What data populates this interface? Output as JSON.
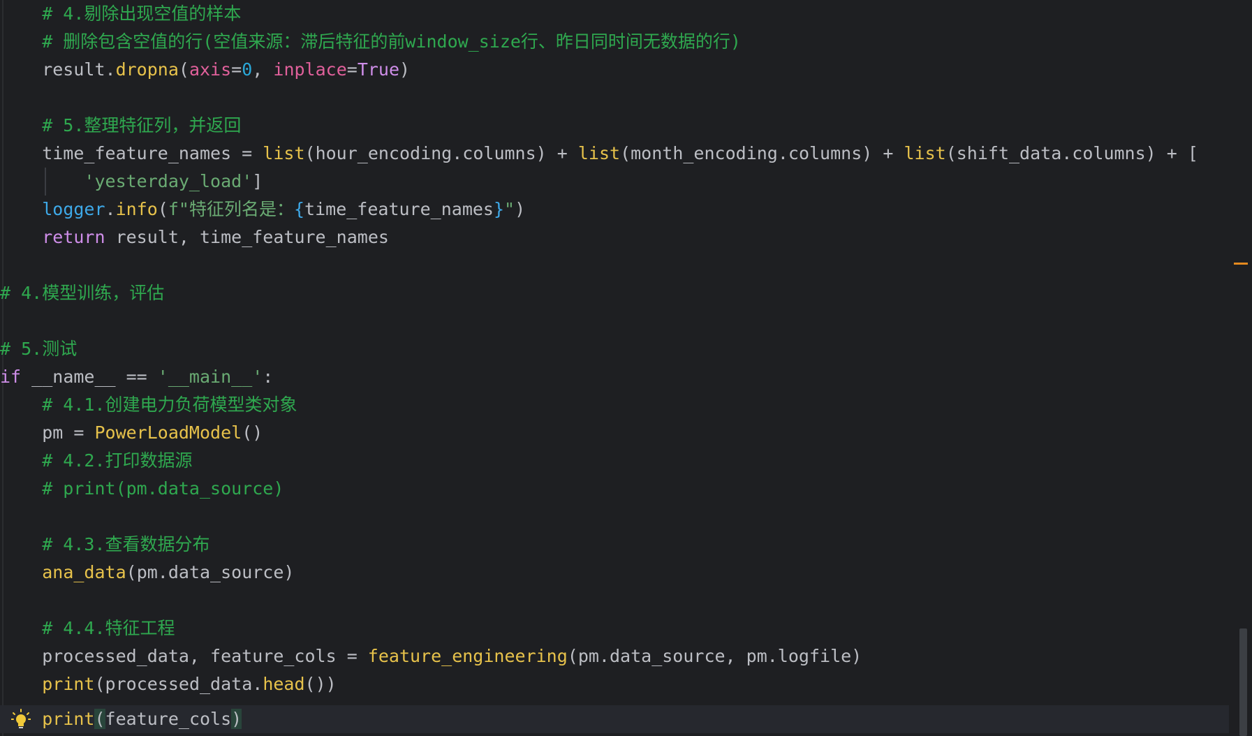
{
  "editor": {
    "language": "python",
    "colors": {
      "background": "#1e1f22",
      "comment": "#2fa84f",
      "function": "#e7c24b",
      "keyword": "#cf8ee9",
      "string": "#6aab73",
      "number": "#2aa8d8",
      "parameter": "#e0609b",
      "text": "#bcbec4",
      "scroll_marker": "#e48a1f"
    },
    "current_line_icon": "lightbulb-icon"
  },
  "code": {
    "l1": {
      "c": "    # 4.剔除出现空值的样本"
    },
    "l2": {
      "c": "    # 删除包含空值的行(空值来源：滞后特征的前window_size行、昨日同时间无数据的行)"
    },
    "l3": {
      "a": "    result.",
      "b": "dropna",
      "c": "(",
      "d": "axis",
      "e": "=",
      "f": "0",
      "g": ", ",
      "h": "inplace",
      "i": "=",
      "j": "True",
      "k": ")"
    },
    "l5": {
      "c": "    # 5.整理特征列，并返回"
    },
    "l6": {
      "a": "    time_feature_names = ",
      "b1": "list",
      "c1": "(hour_encoding.columns) + ",
      "b2": "list",
      "c2": "(month_encoding.columns) + ",
      "b3": "list",
      "c3": "(shift_data.columns) + ["
    },
    "l7": {
      "a": "        ",
      "s": "'yesterday_load'",
      "e": "]"
    },
    "l8": {
      "a": "    ",
      "m": "logger",
      "d": ".",
      "f": "info",
      "p": "(",
      "s1": "f\"特征列名是：",
      "o": "{",
      "v": "time_feature_names",
      "cl": "}",
      "s2": "\"",
      "e": ")"
    },
    "l9": {
      "a": "    ",
      "k": "return",
      "r": " result, time_feature_names"
    },
    "l11": {
      "c": "# 4.模型训练，评估"
    },
    "l13": {
      "c": "# 5.测试"
    },
    "l14": {
      "k": "if",
      "a": " __name__ == ",
      "s": "'__main__'",
      "e": ":"
    },
    "l15": {
      "c": "    # 4.1.创建电力负荷模型类对象"
    },
    "l16": {
      "a": "    pm = ",
      "f": "PowerLoadModel",
      "e": "()"
    },
    "l17": {
      "c": "    # 4.2.打印数据源"
    },
    "l18": {
      "c": "    # print(pm.data_source)"
    },
    "l20": {
      "c": "    # 4.3.查看数据分布"
    },
    "l21": {
      "a": "    ",
      "f": "ana_data",
      "e": "(pm.data_source)"
    },
    "l23": {
      "c": "    # 4.4.特征工程"
    },
    "l24": {
      "a": "    processed_data, feature_cols = ",
      "f": "feature_engineering",
      "e": "(pm.data_source, pm.logfile)"
    },
    "l25": {
      "a": "    ",
      "f1": "print",
      "m": "(processed_data.",
      "f2": "head",
      "e": "())"
    },
    "l26": {
      "a": "    ",
      "f": "print",
      "p1": "(",
      "v": "feature_cols",
      "p2": ")"
    }
  }
}
